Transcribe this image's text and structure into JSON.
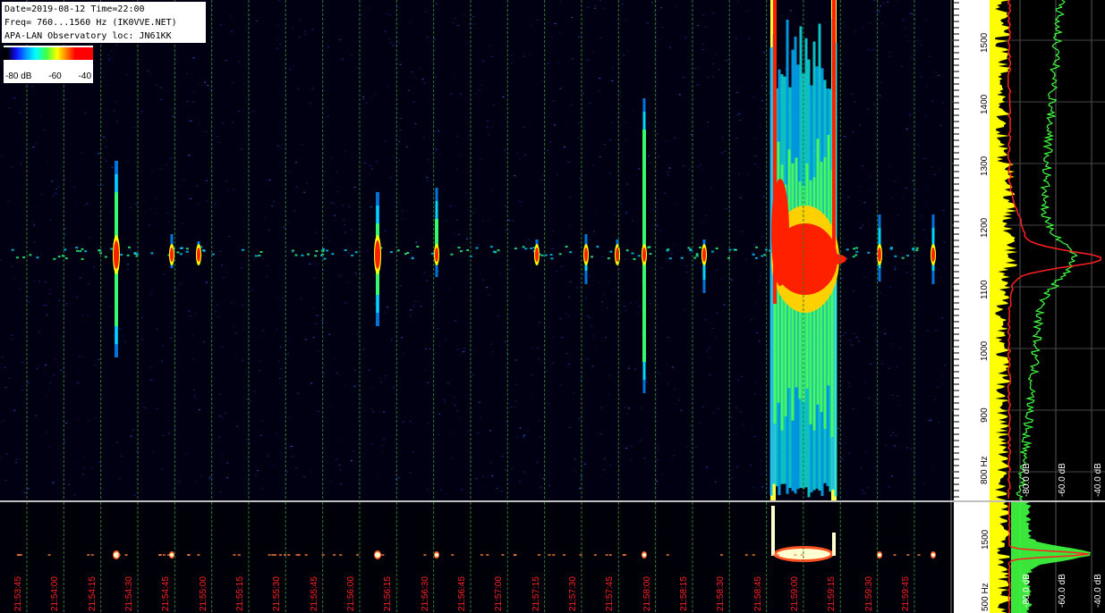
{
  "header": {
    "line1": "Date=2019-08-12 Time=22:00",
    "line2": "Freq= 760...1560 Hz (IK0VVE.NET)",
    "line3": "APA-LAN Observatory loc: JN61KK"
  },
  "colorbar": {
    "min_label": "-80 dB",
    "mid_label": "-60",
    "max_label": "-40"
  },
  "freq_axis_top": [
    "1500",
    "1400",
    "1300",
    "1200",
    "1100",
    "1000",
    "900",
    "800 Hz"
  ],
  "freq_axis_bottom": [
    "1500",
    "500 Hz"
  ],
  "db_labels_top": [
    "-80.0 dB",
    "-60.0 dB",
    "-40.0 dB"
  ],
  "db_labels_bottom": [
    "-80.0 dB",
    "-60.0 dB",
    "-40.0 dB"
  ],
  "time_labels": [
    "21:53:45",
    "21:54:00",
    "21:54:15",
    "21:54:30",
    "21:54:45",
    "21:55:00",
    "21:55:15",
    "21:55:30",
    "21:55:45",
    "21:56:00",
    "21:56:15",
    "21:56:30",
    "21:56:45",
    "21:57:00",
    "21:57:15",
    "21:57:30",
    "21:57:45",
    "21:58:00",
    "21:58:15",
    "21:58:30",
    "21:58:45",
    "21:59:00",
    "21:59:15",
    "21:59:30",
    "21:59:45"
  ],
  "colors": {
    "grid": "#2f7a2f",
    "time_label": "#ff2020",
    "spectrum_red": "#ff2020",
    "spectrum_green": "#40ff40",
    "spectrum_yellow": "#ffff00"
  }
}
